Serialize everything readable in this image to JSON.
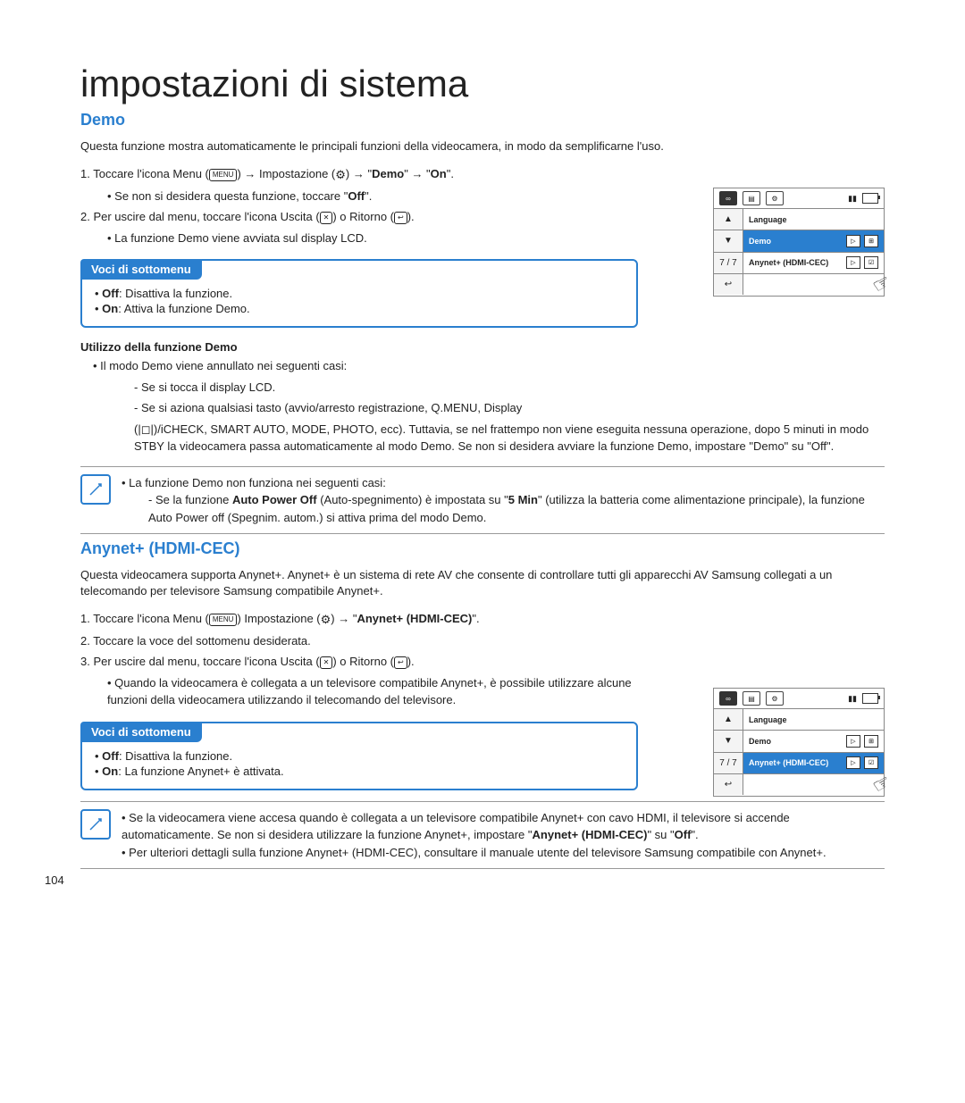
{
  "page_number": "104",
  "title": "impostazioni di sistema",
  "section1": {
    "heading": "Demo",
    "intro": "Questa funzione mostra automaticamente le principali funzioni della videocamera, in modo da semplificarne l'uso.",
    "step1a": "1. Toccare l'icona Menu (",
    "step1b": ") → Impostazione (",
    "step1c": ") → \"",
    "step1d": "Demo",
    "step1e": "\" → \"",
    "step1f": "On",
    "step1g": "\".",
    "step1_sub_pre": "Se non si desidera questa funzione, toccare \"",
    "step1_sub_bold": "Off",
    "step1_sub_post": "\".",
    "step2a": "2. Per uscire dal menu, toccare l'icona Uscita (",
    "step2b": ") o Ritorno (",
    "step2c": ").",
    "step2_sub": "La funzione Demo viene avviata sul display LCD.",
    "submenu_header": "Voci di sottomenu",
    "sub_off_b": "Off",
    "sub_off_t": ": Disattiva la funzione.",
    "sub_on_b": "On",
    "sub_on_t": ": Attiva la funzione Demo.",
    "util_head": "Utilizzo della funzione Demo",
    "util_line": "Il modo Demo viene annullato nei seguenti casi:",
    "util_d1": "Se si tocca il display LCD.",
    "util_d2": "Se si aziona qualsiasi tasto (avvio/arresto registrazione, Q.MENU, Display",
    "util_d3": "(|◻|)/iCHECK, SMART AUTO, MODE, PHOTO, ecc). Tuttavia, se nel frattempo non viene eseguita nessuna operazione, dopo 5 minuti in modo STBY la videocamera passa automaticamente al modo Demo. Se non si desidera avviare la funzione Demo, impostare \"Demo\" su \"Off\".",
    "note_line1": "La funzione Demo non funziona nei seguenti casi:",
    "note_line2a": "Se la funzione ",
    "note_line2b": "Auto Power Off ",
    "note_line2c": "(Auto-spegnimento) è impostata su \"",
    "note_line2d": "5 Min",
    "note_line2e": "\" (utilizza la batteria come alimentazione principale), la funzione Auto Power off (Spegnim. autom.) si attiva prima del modo Demo."
  },
  "section2": {
    "heading": "Anynet+ (HDMI-CEC)",
    "intro": "Questa videocamera supporta Anynet+. Anynet+ è un sistema di rete AV che consente di controllare tutti gli apparecchi AV Samsung collegati a un telecomando per televisore Samsung compatibile Anynet+.",
    "step1a": "1. Toccare l'icona Menu (",
    "step1b": ") Impostazione (",
    "step1c": ") → \"",
    "step1d": "Anynet+ (HDMI-CEC)",
    "step1e": "\".",
    "step2": "2. Toccare la voce del sottomenu desiderata.",
    "step3a": "3. Per uscire dal menu, toccare l'icona Uscita (",
    "step3b": ") o Ritorno (",
    "step3c": ").",
    "step3_sub": "Quando la videocamera è collegata a un televisore compatibile Anynet+, è possibile utilizzare alcune funzioni della videocamera utilizzando il telecomando del televisore.",
    "submenu_header": "Voci di sottomenu",
    "sub_off_b": "Off",
    "sub_off_t": ": Disattiva la funzione.",
    "sub_on_b": "On",
    "sub_on_t": ": La funzione Anynet+ è attivata.",
    "note_line1a": "Se la videocamera viene accesa quando è collegata a un televisore compatibile Anynet+ con cavo HDMI, il televisore si accende automaticamente. Se non si desidera utilizzare la funzione Anynet+, impostare \"",
    "note_line1b": "Anynet+ (HDMI-CEC)",
    "note_line1c": "\" su \"",
    "note_line1d": "Off",
    "note_line1e": "\".",
    "note_line2": "Per ulteriori dettagli sulla funzione Anynet+ (HDMI-CEC), consultare il manuale utente del televisore Samsung compatibile con Anynet+."
  },
  "device1": {
    "page_indicator": "7 / 7",
    "row1": "Language",
    "row2": "Demo",
    "row3": "Anynet+ (HDMI-CEC)"
  },
  "device2": {
    "page_indicator": "7 / 7",
    "row1": "Language",
    "row2": "Demo",
    "row3": "Anynet+ (HDMI-CEC)"
  },
  "icons": {
    "menu_label": "MENU",
    "close": "✕",
    "return": "↩",
    "up": "▲",
    "down": "▼",
    "play": "▷"
  }
}
